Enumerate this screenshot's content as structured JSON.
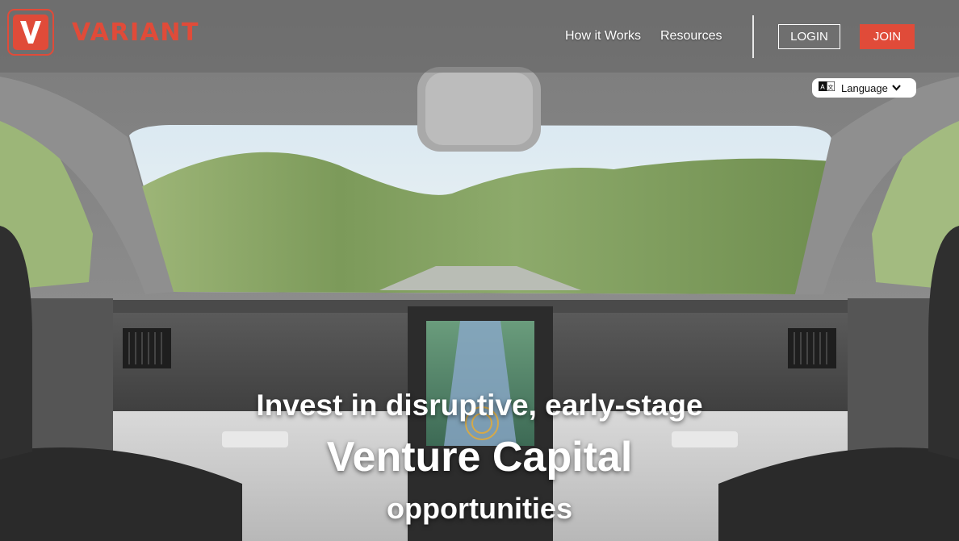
{
  "brand": {
    "name": "VARIANT",
    "color": "#e04b39"
  },
  "nav": {
    "items": [
      {
        "label": "How it Works"
      },
      {
        "label": "Resources"
      }
    ],
    "login_label": "LOGIN",
    "join_label": "JOIN"
  },
  "language": {
    "label": "Language",
    "icon": "translate-icon"
  },
  "hero": {
    "line1": "Invest in disruptive, early-stage",
    "line2": "Venture Capital",
    "line3": "opportunities"
  }
}
